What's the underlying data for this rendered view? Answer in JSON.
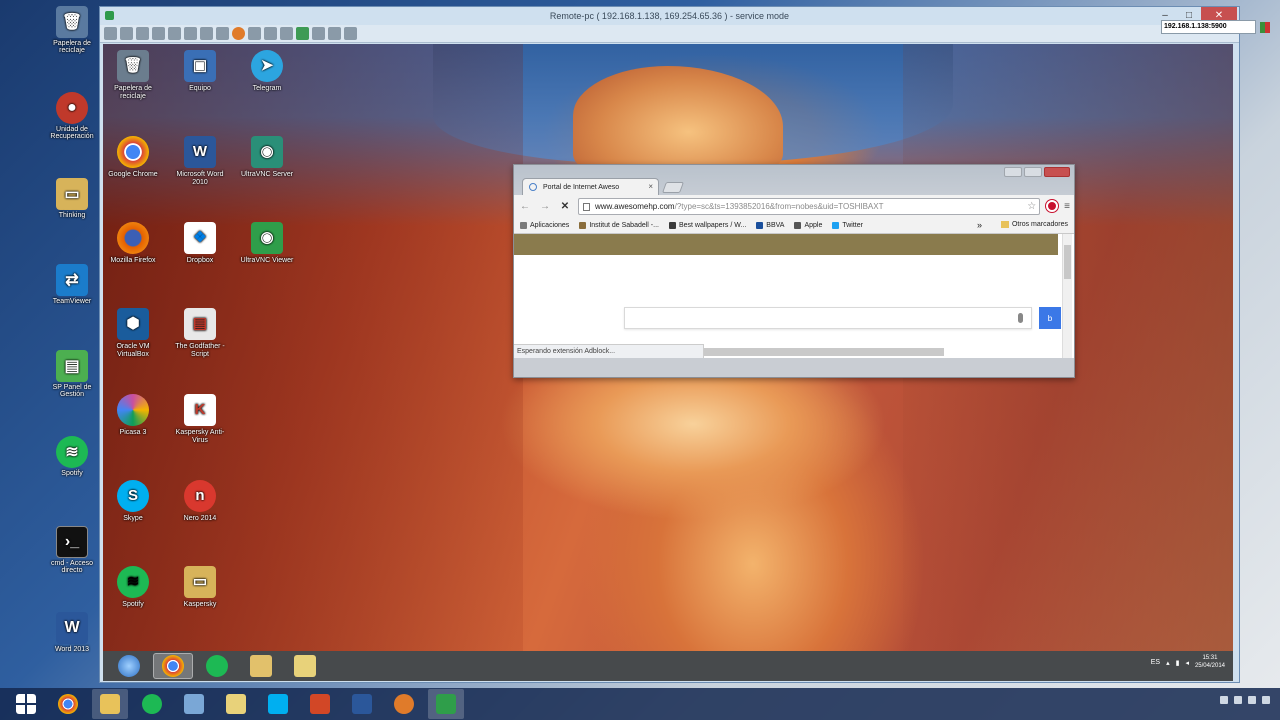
{
  "host_desktop": {
    "icons": [
      {
        "label": "Papelera de reciclaje",
        "color": "#5a7aa0"
      },
      {
        "label": "Unidad de Recuperación",
        "color": "#c0392b"
      },
      {
        "label": "Thinking",
        "color": "#d7b35a"
      },
      {
        "label": "TeamViewer",
        "color": "#1b7ccb"
      },
      {
        "label": "SP Panel de Gestión",
        "color": "#4caf50"
      },
      {
        "label": "Spotify",
        "color": "#1db954"
      },
      {
        "label": "cmd - Acceso directo",
        "color": "#111111"
      },
      {
        "label": "Word 2013",
        "color": "#2b579a"
      }
    ]
  },
  "vnc_window": {
    "title": "Remote-pc ( 192.168.1.138, 169.254.65.36 ) - service mode",
    "buttons": {
      "minimize": "–",
      "maximize": "□",
      "close": "✕"
    },
    "address": "192.168.1.138:5900"
  },
  "remote_desktop": {
    "icons": [
      {
        "label": "Papelera de reciclaje",
        "color": "#6b7d8e"
      },
      {
        "label": "Equipo",
        "color": "#3a6fb6"
      },
      {
        "label": "Telegram",
        "color": "#2ca5e0"
      },
      {
        "label": "Google Chrome",
        "color": "#db4437"
      },
      {
        "label": "Microsoft Word 2010",
        "color": "#2b579a"
      },
      {
        "label": "UltraVNC Server",
        "color": "#2a8f78"
      },
      {
        "label": "Mozilla Firefox",
        "color": "#e66000"
      },
      {
        "label": "Dropbox",
        "color": "#007ee5"
      },
      {
        "label": "UltraVNC Viewer",
        "color": "#2f9e4a"
      },
      {
        "label": "Oracle VM VirtualBox",
        "color": "#1a5c9c"
      },
      {
        "label": "The Godfather - Script",
        "color": "#e8e8e8"
      },
      {
        "label": "Picasa 3",
        "color": "#c94fa0"
      },
      {
        "label": "Kaspersky Anti-Virus",
        "color": "#c0392b"
      },
      {
        "label": "Skype",
        "color": "#00aff0"
      },
      {
        "label": "Nero 2014",
        "color": "#d9382e"
      },
      {
        "label": "Spotify",
        "color": "#1db954"
      },
      {
        "label": "Kaspersky",
        "color": "#d7b35a"
      }
    ],
    "taskbar": {
      "items": [
        {
          "name": "start",
          "color": "#4d8fd6"
        },
        {
          "name": "chrome",
          "color": "#db4437"
        },
        {
          "name": "spotify",
          "color": "#1db954"
        },
        {
          "name": "explorer",
          "color": "#e2c16b"
        },
        {
          "name": "folder",
          "color": "#e8d27a"
        }
      ],
      "lang": "ES",
      "time": "15:31",
      "date": "25/04/2014"
    }
  },
  "chrome": {
    "tab_title": "Portal de Internet Aweso",
    "tab_close": "×",
    "url_host": "www.awesomehp.com",
    "url_rest": "/?type=sc&ts=1393852016&from=nobes&uid=TOSHIBAXT",
    "nav": {
      "back": "←",
      "forward": "→",
      "stop": "✕",
      "star": "☆",
      "menu": "≡"
    },
    "bookmarks": [
      {
        "label": "Aplicaciones",
        "color": "#7a7a7a"
      },
      {
        "label": "Institut de Sabadell -...",
        "color": "#8a6d3b"
      },
      {
        "label": "Best wallpapers / W...",
        "color": "#3a3a3a"
      },
      {
        "label": "BBVA",
        "color": "#1a4f9c"
      },
      {
        "label": "Apple",
        "color": "#555555"
      },
      {
        "label": "Twitter",
        "color": "#1da1f2"
      }
    ],
    "bookmarks_chevron": "»",
    "other_bookmarks": "Otros marcadores",
    "search_button": "b",
    "status": "Esperando extensión Adblock..."
  },
  "host_taskbar": {
    "items": [
      {
        "name": "windows-start",
        "color": "#ffffff"
      },
      {
        "name": "chrome",
        "color": "#db4437"
      },
      {
        "name": "file-explorer",
        "color": "#e8c25a"
      },
      {
        "name": "spotify",
        "color": "#1db954"
      },
      {
        "name": "notepad",
        "color": "#7aa7d6"
      },
      {
        "name": "folder",
        "color": "#e8d27a"
      },
      {
        "name": "skype",
        "color": "#00aff0"
      },
      {
        "name": "powerpoint",
        "color": "#d24726"
      },
      {
        "name": "word",
        "color": "#2b579a"
      },
      {
        "name": "basketball",
        "color": "#e07b2a"
      },
      {
        "name": "ultravnc",
        "color": "#2f9e4a"
      }
    ]
  }
}
